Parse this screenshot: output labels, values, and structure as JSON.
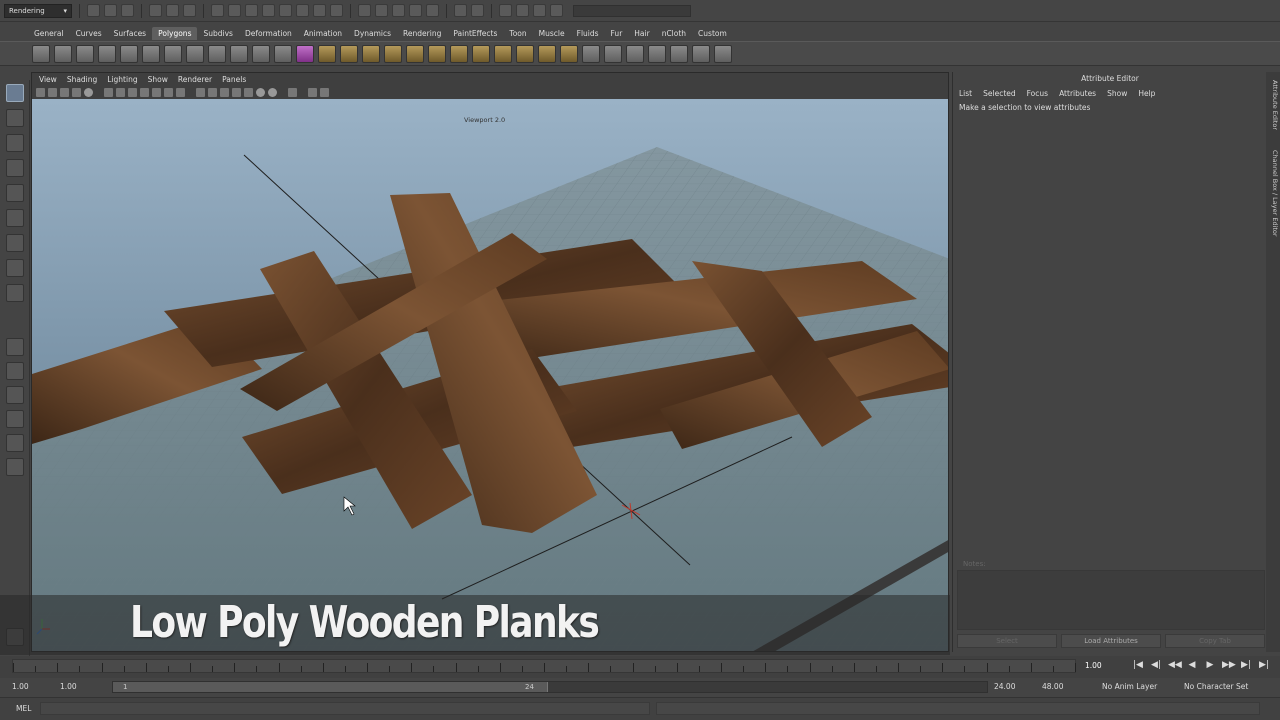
{
  "statusline": {
    "menuset": "Rendering",
    "menuset_arrow": "▾"
  },
  "shelf_tabs": [
    "General",
    "Curves",
    "Surfaces",
    "Polygons",
    "Subdivs",
    "Deformation",
    "Animation",
    "Dynamics",
    "Rendering",
    "PaintEffects",
    "Toon",
    "Muscle",
    "Fluids",
    "Fur",
    "Hair",
    "nCloth",
    "Custom"
  ],
  "active_shelf_tab": "Polygons",
  "viewport": {
    "menus": [
      "View",
      "Shading",
      "Lighting",
      "Show",
      "Renderer",
      "Panels"
    ],
    "renderer_label": "Viewport 2.0"
  },
  "title_overlay": "Low Poly Wooden Planks",
  "attribute_editor": {
    "title": "Attribute Editor",
    "menus": [
      "List",
      "Selected",
      "Focus",
      "Attributes",
      "Show",
      "Help"
    ],
    "hint": "Make a selection to view attributes",
    "notes_label": "Notes:",
    "buttons": [
      "Select",
      "Load Attributes",
      "Copy Tab"
    ]
  },
  "side_tabs": [
    "Attribute Editor",
    "Channel Box / Layer Editor"
  ],
  "timeslider": {
    "current_time": "1.00",
    "controls": [
      "|◀",
      "◀|",
      "◀◀",
      "◀",
      "▶",
      "▶▶",
      "▶|",
      "▶|"
    ]
  },
  "range": {
    "start_time": "1.00",
    "playback_start": "1.00",
    "handle_start": "1",
    "handle_end": "24",
    "playback_end": "24.00",
    "end_time": "48.00",
    "anim_layer": "No Anim Layer",
    "character_set": "No Character Set"
  },
  "cmdline": {
    "label": "MEL"
  },
  "colors": {
    "ui_bg": "#444444",
    "sky_top": "#9ab2c6",
    "sky_bottom": "#5a7488",
    "ground": "#73888f",
    "wood": "#5a3a22"
  }
}
